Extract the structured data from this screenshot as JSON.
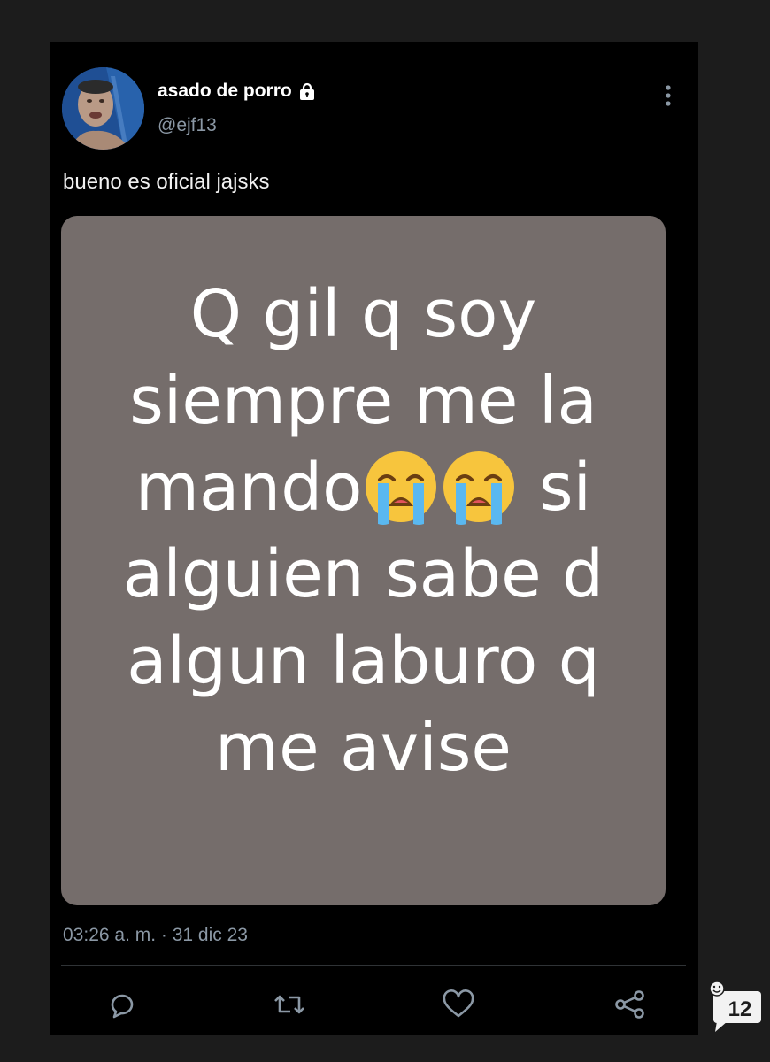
{
  "tweet": {
    "display_name": "asado de porro",
    "handle": "@ejf13",
    "text": "bueno es oficial jajsks",
    "timestamp": "03:26 a. m. · 31 dic 23",
    "locked": true
  },
  "media": {
    "background_color": "#756d6b",
    "line1": "Q gil q soy",
    "line2": "siempre me la",
    "line3_before": "mando",
    "line3_after": " si",
    "line4": "alguien sabe d",
    "line5": "algun laburo q",
    "line6": "me avise",
    "emoji_name": "loudly-crying-face"
  },
  "actions": {
    "reply_icon": "reply-icon",
    "retweet_icon": "retweet-icon",
    "like_icon": "heart-icon",
    "share_icon": "share-icon"
  },
  "watermark": {
    "count": "12"
  },
  "colors": {
    "background": "#1c1c1c",
    "card": "#000000",
    "secondary_text": "#8b98a5"
  }
}
